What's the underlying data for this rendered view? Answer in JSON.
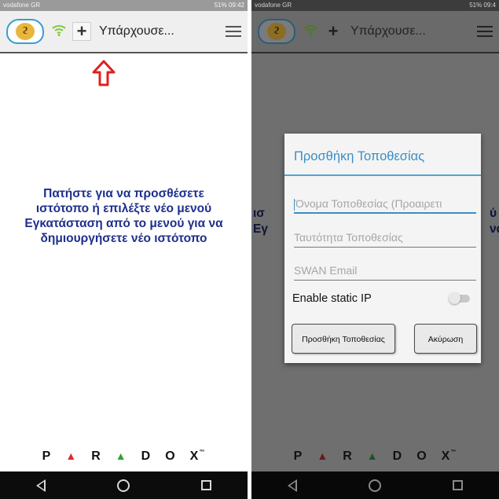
{
  "left": {
    "statusbar": {
      "carrier": "vodafone GR",
      "right": "51% 09:42"
    },
    "appbar": {
      "site": "Υπάρχουσε..."
    },
    "instruction": [
      "Πατήστε για να προσθέσετε",
      "ιστότοπο ή επιλέξτε νέο μενού",
      "Εγκατάσταση από το μενού για να",
      "δημιουργήσετε νέο ιστότοπο"
    ]
  },
  "right": {
    "statusbar": {
      "carrier": "vodafone GR",
      "right": "51% 09:4"
    },
    "appbar": {
      "site": "Υπάρχουσε..."
    },
    "dialog": {
      "title": "Προσθήκη Τοποθεσίας",
      "name_placeholder": "Όνομα Τοποθεσίας (Προαιρετι",
      "id_placeholder": "Ταυτότητα Τοποθεσίας",
      "email_placeholder": "SWAN Email",
      "static_ip_label": "Enable static IP",
      "static_ip_enabled": false,
      "add_button": "Προσθήκη Τοποθεσίας",
      "cancel_button": "Ακύρωση"
    }
  },
  "brand": {
    "letters": [
      "P",
      "R",
      "D",
      "O",
      "X"
    ],
    "tm": "™"
  },
  "icons": [
    "cloud-swan-logo-icon",
    "wifi-icon",
    "plus-icon",
    "menu-icon",
    "up-arrow-icon",
    "back-icon",
    "home-icon",
    "recents-icon"
  ],
  "colors": {
    "accent": "#3a8ec6",
    "instruction": "#1e2f8c",
    "wifi": "#7ecb3a",
    "arrow": "#e02020",
    "triangle_red": "#e02b2b",
    "triangle_green": "#2aa23a"
  }
}
